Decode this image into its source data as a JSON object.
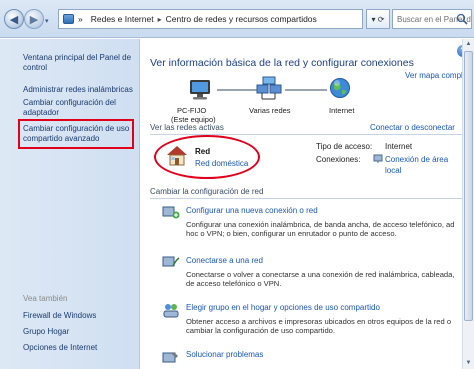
{
  "window": {
    "minimize": "—",
    "maximize": "□",
    "close": "✕"
  },
  "addressbar": {
    "sep_prefix": "»",
    "crumb1": "Redes e Internet",
    "sep": "▸",
    "crumb2": "Centro de redes y recursos compartidos",
    "refresh": "▾ ⟳",
    "search_placeholder": "Buscar en el Panel de control"
  },
  "sidebar": {
    "items": [
      {
        "label": "Ventana principal del Panel de control"
      },
      {
        "label": "Administrar redes inalámbricas"
      },
      {
        "label": "Cambiar configuración del adaptador"
      },
      {
        "label": "Cambiar configuración de uso compartido avanzado"
      }
    ],
    "see_also": "Vea también",
    "also_items": [
      {
        "label": "Firewall de Windows"
      },
      {
        "label": "Grupo Hogar"
      },
      {
        "label": "Opciones de Internet"
      }
    ]
  },
  "main": {
    "title": "Ver información básica de la red y configurar conexiones",
    "full_map": "Ver mapa completo",
    "netmap": {
      "pc": "PC-FIJO",
      "pc_sub": "(Este equipo)",
      "middle": "Varias redes",
      "internet": "Internet"
    },
    "active_label": "Ver las redes activas",
    "connect_link": "Conectar o desconectar",
    "network": {
      "name": "Red",
      "type": "Red doméstica",
      "access_label": "Tipo de acceso:",
      "access_value": "Internet",
      "connections_label": "Conexiones:",
      "connections_value_1": "Conexión de área",
      "connections_value_2": "local"
    },
    "change_label": "Cambiar la configuración de red",
    "tasks": [
      {
        "title": "Configurar una nueva conexión o red",
        "desc": "Configurar una conexión inalámbrica, de banda ancha, de acceso telefónico, ad hoc o VPN; o bien, configurar un enrutador o punto de acceso."
      },
      {
        "title": "Conectarse a una red",
        "desc": "Conectarse o volver a conectarse a una conexión de red inalámbrica, cableada, de acceso telefónico o VPN."
      },
      {
        "title": "Elegir grupo en el hogar y opciones de uso compartido",
        "desc": "Obtener acceso a archivos e impresoras ubicados en otros equipos de la red o cambiar la configuración de uso compartido."
      },
      {
        "title": "Solucionar problemas",
        "desc": ""
      }
    ]
  },
  "colors": {
    "link": "#1a57b8",
    "title": "#1c3f86",
    "highlight": "#e0001b"
  }
}
